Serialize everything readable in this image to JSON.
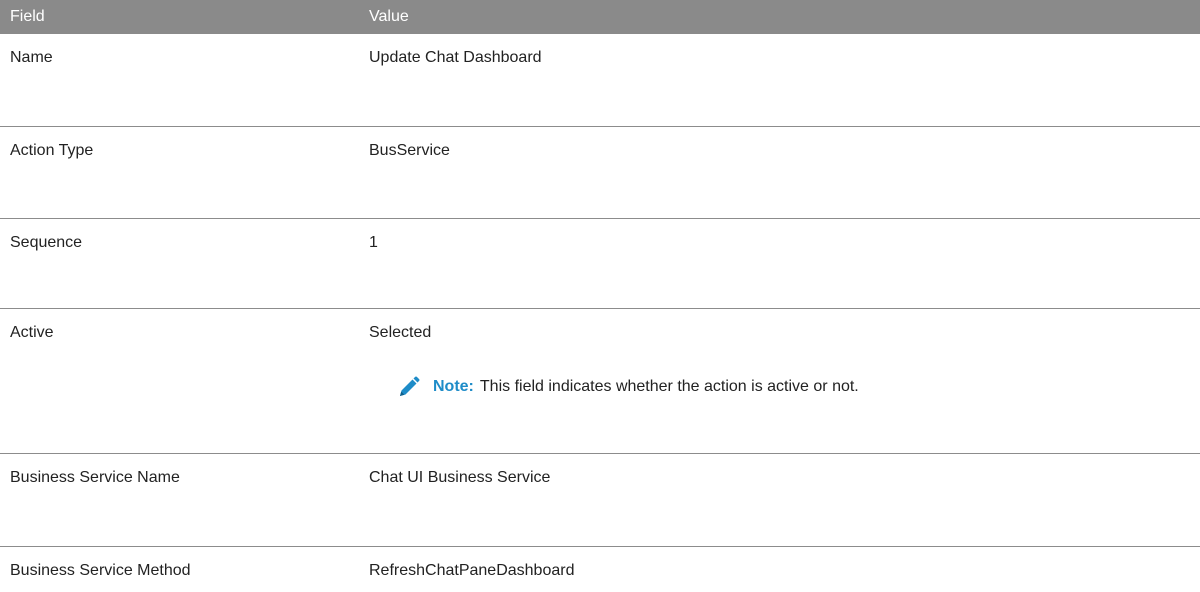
{
  "table": {
    "header": {
      "field": "Field",
      "value": "Value"
    },
    "rows": [
      {
        "field": "Name",
        "value": "Update Chat Dashboard"
      },
      {
        "field": "Action Type",
        "value": "BusService"
      },
      {
        "field": "Sequence",
        "value": "1"
      },
      {
        "field": "Active",
        "value": "Selected"
      },
      {
        "field": "Business Service Name",
        "value": "Chat UI Business Service"
      },
      {
        "field": "Business Service Method",
        "value": "RefreshChatPaneDashboard"
      }
    ],
    "note": {
      "label": "Note:",
      "text": "This field indicates whether the action is active or not.",
      "icon": "pencil-icon"
    }
  },
  "colors": {
    "header_bg": "#8a8a8a",
    "note_accent": "#1e8cc8"
  }
}
